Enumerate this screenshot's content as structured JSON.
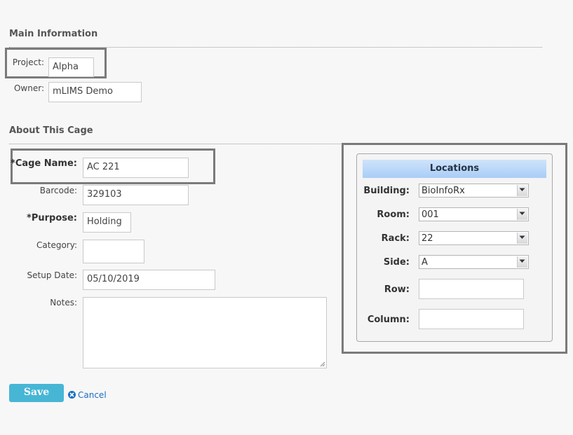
{
  "main_info": {
    "title": "Main Information",
    "project_label": "Project:",
    "project_value": "Alpha",
    "owner_label": "Owner:",
    "owner_value": "mLIMS Demo"
  },
  "cage": {
    "title": "About This Cage",
    "name_label": "*Cage Name:",
    "name_value": "AC 221",
    "barcode_label": "Barcode:",
    "barcode_value": "329103",
    "purpose_label": "*Purpose:",
    "purpose_value": "Holding",
    "category_label": "Category:",
    "category_value": "",
    "setup_label": "Setup Date:",
    "setup_value": "05/10/2019",
    "notes_label": "Notes:",
    "notes_value": ""
  },
  "locations": {
    "title": "Locations",
    "building_label": "Building:",
    "building_value": "BioInfoRx",
    "room_label": "Room:",
    "room_value": "001",
    "rack_label": "Rack:",
    "rack_value": "22",
    "side_label": "Side:",
    "side_value": "A",
    "row_label": "Row:",
    "row_value": "",
    "column_label": "Column:",
    "column_value": ""
  },
  "actions": {
    "save_label": "Save",
    "cancel_label": "Cancel"
  },
  "colors": {
    "accent": "#47b6d5",
    "link": "#1a6fc2",
    "highlight_border": "#7a7a7a",
    "locations_header": "#a9cdf6"
  }
}
